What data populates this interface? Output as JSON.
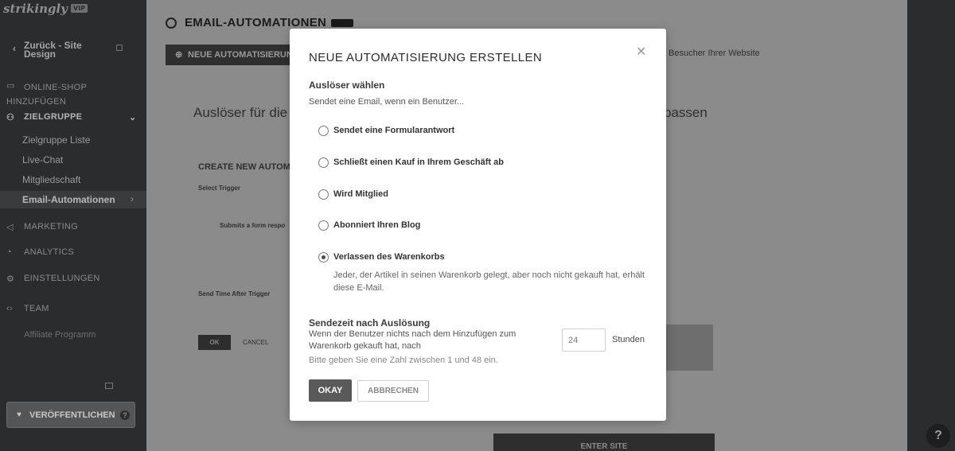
{
  "sidebar": {
    "logo": "strikingly",
    "logo_badge": "VIP",
    "back_label": "Zurück - Site Design",
    "nav": [
      {
        "label": "ONLINE-SHOP HINZUFÜGEN",
        "icon": "shop-icon"
      },
      {
        "label": "ZIELGRUPPE",
        "icon": "people-icon"
      },
      {
        "label": "MARKETING",
        "icon": "megaphone-icon"
      },
      {
        "label": "ANALYTICS",
        "icon": "chart-icon"
      },
      {
        "label": "EINSTELLUNGEN",
        "icon": "gear-icon"
      },
      {
        "label": "TEAM",
        "icon": "team-icon"
      }
    ],
    "subnav": [
      "Zielgruppe Liste",
      "Live-Chat",
      "Mitgliedschaft",
      "Email-Automationen"
    ],
    "affiliate": "Affiliate Programm",
    "publish_label": "VERÖFFENTLICHEN"
  },
  "main": {
    "title": "EMAIL-AUTOMATIONEN",
    "new_button": "NEUE AUTOMATISIERUNG",
    "bg_heading_left": "Auslöser für die",
    "bg_heading_right": "passen",
    "bg_side_text": "Besucher Ihrer Website",
    "bg_form_title": "CREATE NEW AUTOMA",
    "bg_select_trigger": "Select Trigger",
    "bg_option": "Submits a form respo",
    "bg_send_time": "Send Time After Trigger",
    "bg_ok": "OK",
    "bg_cancel": "CANCEL",
    "enter_site": "ENTER SITE",
    "help": "?"
  },
  "modal": {
    "title": "NEUE AUTOMATISIERUNG ERSTELLEN",
    "trigger_title": "Auslöser wählen",
    "trigger_sub": "Sendet eine Email, wenn ein Benutzer...",
    "options": [
      {
        "label": "Sendet eine Formularantwort",
        "selected": false
      },
      {
        "label": "Schließt einen Kauf in Ihrem Geschäft ab",
        "selected": false
      },
      {
        "label": "Wird Mitglied",
        "selected": false
      },
      {
        "label": "Abonniert Ihren Blog",
        "selected": false
      },
      {
        "label": "Verlassen des Warenkorbs",
        "selected": true
      }
    ],
    "selected_description": "Jeder, der Artikel in seinen Warenkorb gelegt, aber noch nicht gekauft hat, erhält diese E-Mail.",
    "send_title": "Sendezeit nach Auslösung",
    "send_description": "Wenn der Benutzer nichts nach dem Hinzufügen zum Warenkorb gekauft hat, nach",
    "hours_value": "24",
    "hours_label": "Stunden",
    "hint": "Bitte geben Sie eine Zahl zwischen 1 und 48 ein.",
    "okay_label": "OKAY",
    "cancel_label": "ABBRECHEN"
  }
}
